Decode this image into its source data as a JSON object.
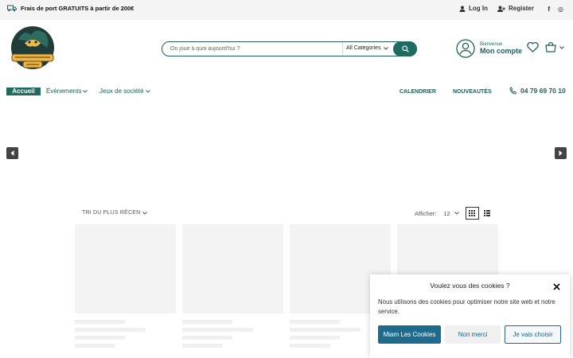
{
  "topbar": {
    "shipping": "Frais de port GRATUITS à partir de 200€",
    "login": "Log In",
    "register": "Register",
    "social": [
      "f",
      "◎"
    ]
  },
  "header": {
    "logo_text": "Gricktlard Jeux",
    "search_placeholder": "On joue à quoi aujourd'hui ?",
    "category": "All Categories",
    "welcome": "Bienvenue",
    "account": "Mon compte"
  },
  "nav": {
    "home": "Accueil",
    "events": "Évènements",
    "board_games": "Jeux de société",
    "calendar": "CALENDRIER",
    "news": "NOUVEAUTÉS",
    "phone": "04 79 69 70 10"
  },
  "listing": {
    "sort": "TRI DU PLUS RÉCEN",
    "show_label": "Afficher:",
    "per_page": "12"
  },
  "cookie": {
    "title": "Voulez vous des cookies ?",
    "text": "Nous utilisons des cookies pour optimiser notre site web et notre service.",
    "accept": "Miam Les Cookies",
    "decline": "Non merci",
    "choose": "Je vais choisir"
  },
  "colors": {
    "brand": "#1f6b62",
    "cookie_accent": "#1f6b8e"
  }
}
